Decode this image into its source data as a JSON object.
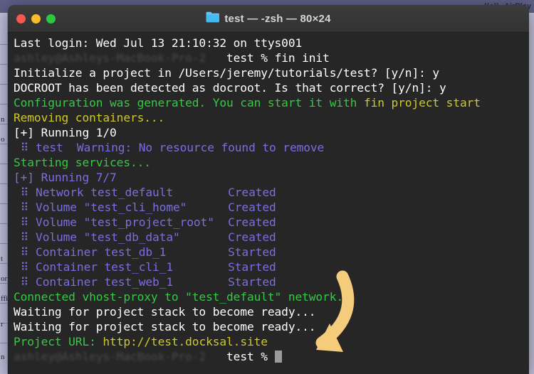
{
  "desktop": {
    "menu_bar_items": [
      "((o))",
      "AirPlay"
    ]
  },
  "window": {
    "title": "test — -zsh — 80×24",
    "folder_icon": "folder-icon",
    "controls": {
      "close": "close-button",
      "minimize": "minimize-button",
      "maximize": "maximize-button"
    }
  },
  "terminal": {
    "colors": {
      "background": "#262626",
      "white": "#ffffff",
      "green": "#35c945",
      "yellow": "#cfc925",
      "purple": "#7a6ee0",
      "cursor": "#9a9a9a"
    },
    "lines": [
      {
        "id": "l1",
        "segments": [
          {
            "text": "Last login: Wed Jul 13 21:10:32 on ttys001",
            "color": "white"
          }
        ]
      },
      {
        "id": "l2",
        "segments": [
          {
            "text": "ashley@Ashleys-MacBook-Pro-2",
            "color": "blur"
          },
          {
            "text": "   test % ",
            "color": "white"
          },
          {
            "text": "fin init",
            "color": "white"
          }
        ]
      },
      {
        "id": "l3",
        "segments": [
          {
            "text": "Initialize a project in /Users/jeremy/tutorials/test? [y/n]: y",
            "color": "white"
          }
        ]
      },
      {
        "id": "l4",
        "segments": [
          {
            "text": "DOCROOT has been detected as docroot. Is that correct? [y/n]: y",
            "color": "white"
          }
        ]
      },
      {
        "id": "l5",
        "segments": [
          {
            "text": "Configuration was generated. You can start it with ",
            "color": "green"
          },
          {
            "text": "fin project start",
            "color": "yellow"
          }
        ]
      },
      {
        "id": "l6",
        "segments": [
          {
            "text": "Removing containers...",
            "color": "yellow"
          }
        ]
      },
      {
        "id": "l7",
        "segments": [
          {
            "text": "[+] Running 1/0",
            "color": "white"
          }
        ]
      },
      {
        "id": "l8",
        "segments": [
          {
            "text": " ⠿ test  Warning: No resource found to remove",
            "color": "purple"
          }
        ]
      },
      {
        "id": "l9",
        "segments": [
          {
            "text": "Starting services...",
            "color": "green"
          }
        ]
      },
      {
        "id": "l10",
        "segments": [
          {
            "text": "[+] Running 7/7",
            "color": "purple"
          }
        ]
      },
      {
        "id": "l11",
        "segments": [
          {
            "text": " ⠿ Network test_default        Created",
            "color": "purple"
          }
        ]
      },
      {
        "id": "l12",
        "segments": [
          {
            "text": " ⠿ Volume \"test_cli_home\"      Created",
            "color": "purple"
          }
        ]
      },
      {
        "id": "l13",
        "segments": [
          {
            "text": " ⠿ Volume \"test_project_root\"  Created",
            "color": "purple"
          }
        ]
      },
      {
        "id": "l14",
        "segments": [
          {
            "text": " ⠿ Volume \"test_db_data\"       Created",
            "color": "purple"
          }
        ]
      },
      {
        "id": "l15",
        "segments": [
          {
            "text": " ⠿ Container test_db_1         Started",
            "color": "purple"
          }
        ]
      },
      {
        "id": "l16",
        "segments": [
          {
            "text": " ⠿ Container test_cli_1        Started",
            "color": "purple"
          }
        ]
      },
      {
        "id": "l17",
        "segments": [
          {
            "text": " ⠿ Container test_web_1        Started",
            "color": "purple"
          }
        ]
      },
      {
        "id": "l18",
        "segments": [
          {
            "text": "Connected vhost-proxy to \"test_default\" network.",
            "color": "green"
          }
        ]
      },
      {
        "id": "l19",
        "segments": [
          {
            "text": "Waiting for project stack to become ready...",
            "color": "white"
          }
        ]
      },
      {
        "id": "l20",
        "segments": [
          {
            "text": "Waiting for project stack to become ready...",
            "color": "white"
          }
        ]
      },
      {
        "id": "l21",
        "segments": [
          {
            "text": "Project URL: ",
            "color": "green"
          },
          {
            "text": "http://test.docksal.site",
            "color": "yellow"
          }
        ]
      },
      {
        "id": "l22",
        "segments": [
          {
            "text": "ashley@Ashleys-MacBook-Pro-2",
            "color": "blur"
          },
          {
            "text": "   test % ",
            "color": "white"
          },
          {
            "cursor": true
          }
        ]
      }
    ]
  },
  "annotation": {
    "arrow": {
      "name": "pointer-arrow",
      "color": "#f5cc7c",
      "description": "curved arrow pointing to terminal prompt cursor"
    }
  },
  "background_app": {
    "cell_labels": [
      "n",
      "o",
      "t",
      "or",
      "ffi",
      "r",
      "n"
    ]
  }
}
